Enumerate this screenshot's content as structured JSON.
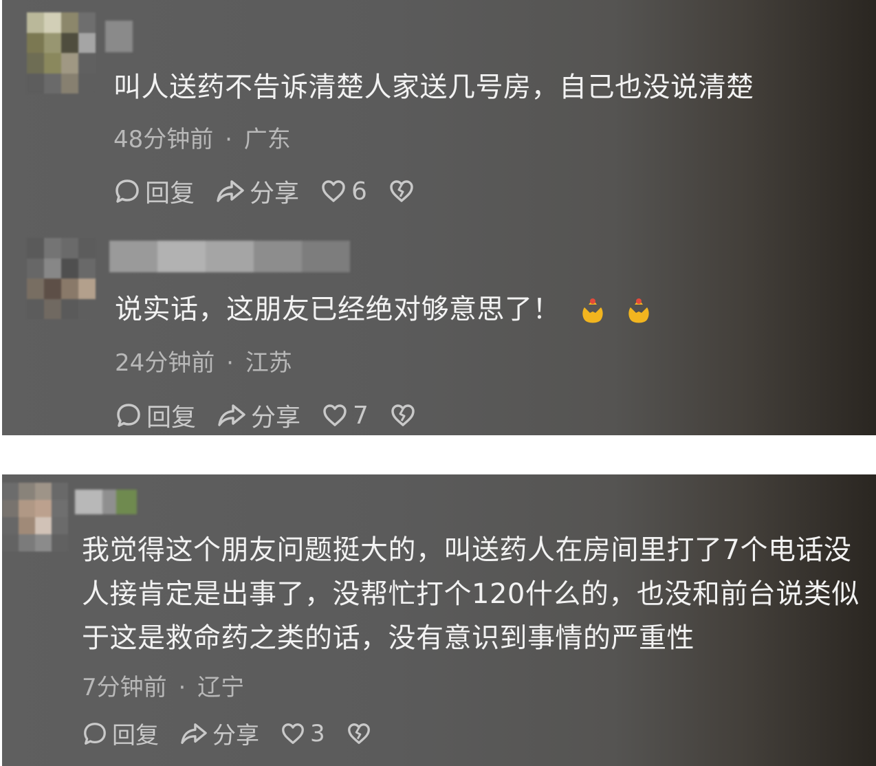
{
  "comments": [
    {
      "text": "叫人送药不告诉清楚人家送几号房，自己也没说清楚",
      "time": "48分钟前",
      "location": "广东",
      "reply_label": "回复",
      "share_label": "分享",
      "likes": "6"
    },
    {
      "text": "说实话，这朋友已经绝对够意思了！",
      "emoji": [
        "pray-hands-emoji",
        "pray-hands-emoji"
      ],
      "time": "24分钟前",
      "location": "江苏",
      "reply_label": "回复",
      "share_label": "分享",
      "likes": "7"
    },
    {
      "text_lines": [
        "我觉得这个朋友问题挺大的，叫送药人在房间里打了7个电话没",
        "人接肯定是出事了，没帮忙打个120什么的，也没和前台说类似",
        "于这是救命药之类的话，没有意识到事情的严重性"
      ],
      "time": "7分钟前",
      "location": "辽宁",
      "reply_label": "回复",
      "share_label": "分享",
      "likes": "3"
    }
  ],
  "separator": "·",
  "colors": {
    "panel_dark": "#2a2621",
    "panel_gray": "#5f5f5f",
    "text": "#f2f2f2",
    "meta": "#b8b8b8",
    "actions": "#c9c9c9"
  },
  "icons": {
    "reply": "comment-bubble-icon",
    "share": "share-arrow-icon",
    "like": "heart-outline-icon",
    "dislike": "broken-heart-icon"
  }
}
